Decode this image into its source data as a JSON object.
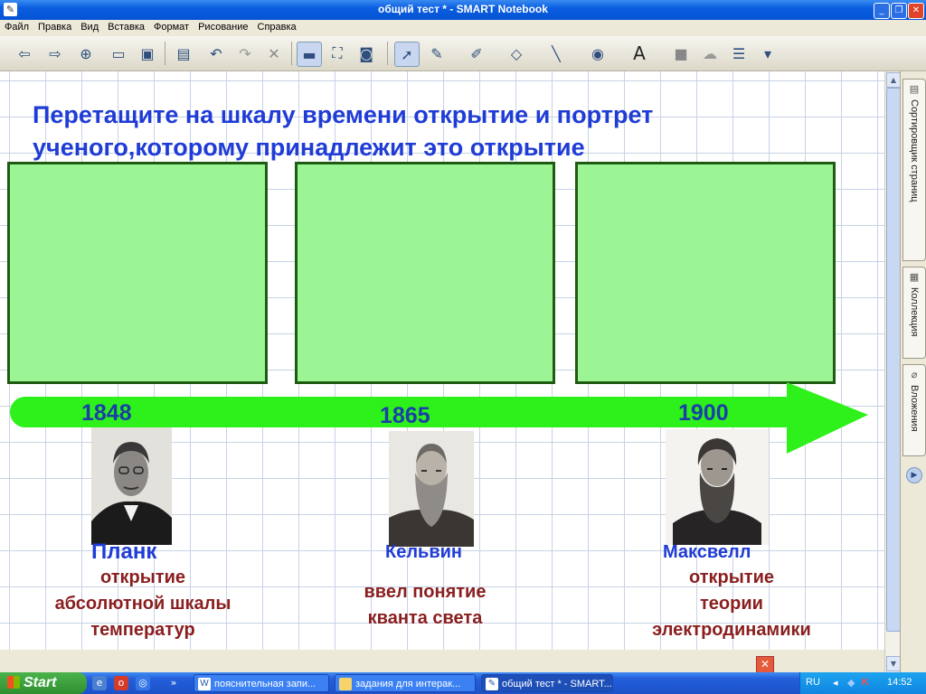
{
  "window": {
    "title": "общий тест * - SMART Notebook",
    "app_icon": "smart-notebook-icon",
    "buttons": [
      "minimize-icon",
      "restore-icon",
      "close-icon"
    ]
  },
  "menu": [
    "Файл",
    "Правка",
    "Вид",
    "Вставка",
    "Формат",
    "Рисование",
    "Справка"
  ],
  "toolbar": {
    "icons": [
      "back-icon",
      "forward-icon",
      "add-page-icon",
      "open-icon",
      "save-icon",
      "paste-icon",
      "undo-icon",
      "redo-icon",
      "delete-icon",
      "screen-shade-icon",
      "full-screen-icon",
      "capture-icon",
      "select-icon",
      "pen-icon",
      "creative-pen-icon",
      "eraser-icon",
      "line-icon",
      "fill-icon",
      "text-icon",
      "shapes-icon",
      "cloud-icon",
      "table-icon",
      "more-icon"
    ]
  },
  "page": {
    "heading": "Перетащите на шкалу времени открытие и портрет ученого,которому принадлежит это открытие",
    "years": [
      "1848",
      "1865",
      "1900"
    ],
    "scientists": [
      {
        "name": "Планк",
        "discovery": [
          "открытие",
          "абсолютной шкалы",
          "температур"
        ]
      },
      {
        "name": "Кельвин",
        "discovery": [
          "ввел понятие",
          "кванта света"
        ]
      },
      {
        "name": "Максвелл",
        "discovery": [
          "открытие",
          "теории",
          "электродинамики"
        ]
      }
    ],
    "colors": {
      "heading": "#1f3cd6",
      "box_fill": "#9bf595",
      "box_border": "#1f5b12",
      "arrow": "#2ef01a",
      "year": "#1a3fa8",
      "discovery": "#8a1e1e"
    }
  },
  "side_tabs": [
    "Сортировщик страниц",
    "Коллекция",
    "Вложения"
  ],
  "taskbar": {
    "start": "Start",
    "tasks": [
      "пояснительная запи...",
      "задания для интерак...",
      "общий тест * - SMART..."
    ],
    "lang": "RU",
    "clock": "14:52"
  }
}
